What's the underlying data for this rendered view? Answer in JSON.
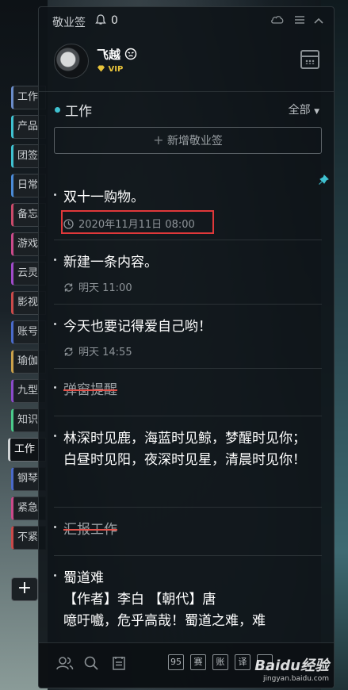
{
  "window": {
    "app_title": "敬业签",
    "notification_count": "0"
  },
  "user": {
    "name": "飞越",
    "badge": "VIP"
  },
  "sidebar_tabs": [
    "工作",
    "产品",
    "团签",
    "日常",
    "备忘",
    "游戏",
    "云灵",
    "影视",
    "账号",
    "瑜伽",
    "九型",
    "知识",
    "工作",
    "钢琴",
    "紧急",
    "不紧"
  ],
  "active_tab_index": 12,
  "category": {
    "title": "工作",
    "filter": "全部"
  },
  "add_button_label": "新增敬业签",
  "items": [
    {
      "title": "双十一购物。",
      "time": "2020年11月11日 08:00",
      "time_icon": "clock-icon",
      "done": false,
      "pinned": true
    },
    {
      "title": "新建一条内容。",
      "time": "明天 11:00",
      "time_icon": "repeat-icon",
      "done": false
    },
    {
      "title": "今天也要记得爱自己哟！",
      "time": "明天 14:55",
      "time_icon": "repeat-icon",
      "done": false
    },
    {
      "title": "弹窗提醒",
      "done": true
    },
    {
      "title": "林深时见鹿，海蓝时见鲸，梦醒时见你；白昼时见阳，夜深时见星，清晨时见你！",
      "done": false
    },
    {
      "title": "汇报工作",
      "done": true
    },
    {
      "title": "蜀道难",
      "body_lines": [
        "【作者】李白 【朝代】唐",
        "噫吁嚱，危乎高哉！蜀道之难，难"
      ],
      "done": false
    }
  ],
  "bottom_toolbar": {
    "boxes": [
      "95",
      "赛",
      "账",
      "译"
    ]
  },
  "watermark": {
    "logo": "Baidu经验",
    "url": "jingyan.baidu.com"
  },
  "colors": {
    "accent": "#3fc1d0",
    "highlight_box": "#e0383a",
    "strike": "#e2524a",
    "vip": "#e8c33a"
  }
}
